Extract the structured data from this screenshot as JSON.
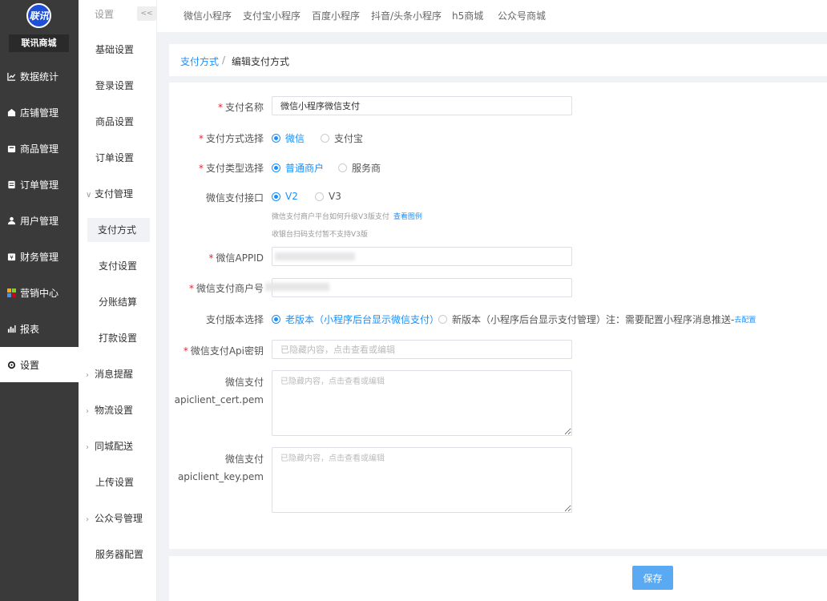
{
  "brand": {
    "logo_text": "联讯",
    "name": "联讯商城"
  },
  "sidebar": {
    "items": [
      {
        "label": "数据统计",
        "icon": "chart-line-icon"
      },
      {
        "label": "店铺管理",
        "icon": "store-icon"
      },
      {
        "label": "商品管理",
        "icon": "box-icon"
      },
      {
        "label": "订单管理",
        "icon": "order-icon"
      },
      {
        "label": "用户管理",
        "icon": "user-icon"
      },
      {
        "label": "财务管理",
        "icon": "finance-icon"
      },
      {
        "label": "营销中心",
        "icon": "marketing-icon"
      },
      {
        "label": "报表",
        "icon": "bar-chart-icon"
      },
      {
        "label": "设置",
        "icon": "gear-icon"
      }
    ]
  },
  "submenu": {
    "title": "设置",
    "collapse": "<<",
    "items": [
      {
        "label": "基础设置"
      },
      {
        "label": "登录设置"
      },
      {
        "label": "商品设置"
      },
      {
        "label": "订单设置"
      },
      {
        "label": "支付管理"
      },
      {
        "label": "支付方式"
      },
      {
        "label": "支付设置"
      },
      {
        "label": "分账结算"
      },
      {
        "label": "打款设置"
      },
      {
        "label": "消息提醒"
      },
      {
        "label": "物流设置"
      },
      {
        "label": "同城配送"
      },
      {
        "label": "上传设置"
      },
      {
        "label": "公众号管理"
      },
      {
        "label": "服务器配置"
      }
    ]
  },
  "topnav": {
    "tabs": [
      "微信小程序",
      "支付宝小程序",
      "百度小程序",
      "抖音/头条小程序",
      "h5商城",
      "公众号商城"
    ]
  },
  "breadcrumb": {
    "link": "支付方式",
    "sep": "/",
    "current": "编辑支付方式"
  },
  "form": {
    "name_label": "支付名称",
    "name_value": "微信小程序微信支付",
    "method_label": "支付方式选择",
    "method_options": [
      "微信",
      "支付宝"
    ],
    "type_label": "支付类型选择",
    "type_options": [
      "普通商户",
      "服务商"
    ],
    "api_label": "微信支付接口",
    "api_options": [
      "V2",
      "V3"
    ],
    "api_hint": "微信支付商户平台如何升级V3版支付",
    "api_hint_link": "查看图例",
    "api_hint2": "收银台扫码支付暂不支持V3版",
    "appid_label": "微信APPID",
    "mchid_label": "微信支付商户号",
    "version_label": "支付版本选择",
    "version_options": [
      "老版本（小程序后台显示微信支付）",
      "新版本（小程序后台显示支付管理）注：需要配置小程序消息推送-"
    ],
    "version_link": "去配置",
    "apikey_label": "微信支付Api密钥",
    "apikey_placeholder": "已隐藏内容，点击查看或编辑",
    "cert_label_1": "微信支付",
    "cert_label_2": "apiclient_cert.pem",
    "cert_placeholder": "已隐藏内容，点击查看或编辑",
    "key_label_1": "微信支付",
    "key_label_2": "apiclient_key.pem",
    "key_placeholder": "已隐藏内容，点击查看或编辑"
  },
  "footer": {
    "save_label": "保存"
  },
  "colors": {
    "accent": "#1890ff",
    "sidebar_bg": "#3a3a3a",
    "save_button": "#5aa9f3"
  }
}
